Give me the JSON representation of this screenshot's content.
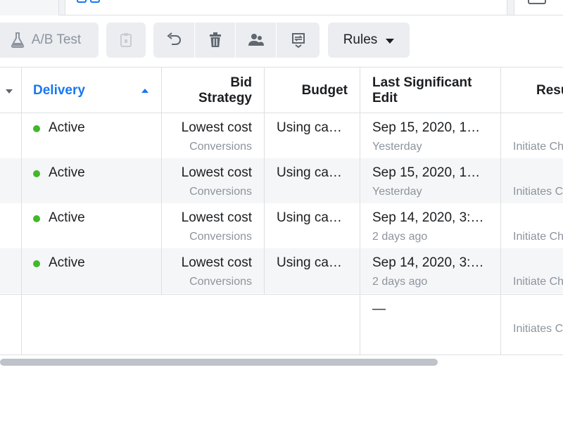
{
  "toolbar": {
    "ab_test_label": "A/B Test",
    "rules_label": "Rules"
  },
  "table": {
    "headers": {
      "delivery": "Delivery",
      "bid_strategy_line1": "Bid",
      "bid_strategy_line2": "Strategy",
      "budget": "Budget",
      "last_edit_line1": "Last Significant",
      "last_edit_line2": "Edit",
      "results": "Resu"
    },
    "rows": [
      {
        "delivery": "Active",
        "bid": "Lowest cost",
        "bid_sub": "Conversions",
        "budget": "Using ca…",
        "edit": "Sep 15, 2020, 1…",
        "edit_sub": "Yesterday",
        "results_sub": "Initiate Ch"
      },
      {
        "delivery": "Active",
        "bid": "Lowest cost",
        "bid_sub": "Conversions",
        "budget": "Using ca…",
        "edit": "Sep 15, 2020, 1…",
        "edit_sub": "Yesterday",
        "results_sub": "Initiates C"
      },
      {
        "delivery": "Active",
        "bid": "Lowest cost",
        "bid_sub": "Conversions",
        "budget": "Using ca…",
        "edit": "Sep 14, 2020, 3:…",
        "edit_sub": "2 days ago",
        "results_sub": "Initiate Ch"
      },
      {
        "delivery": "Active",
        "bid": "Lowest cost",
        "bid_sub": "Conversions",
        "budget": "Using ca…",
        "edit": "Sep 14, 2020, 3:…",
        "edit_sub": "2 days ago",
        "results_sub": "Initiate Ch"
      }
    ],
    "totals": {
      "edit": "—",
      "results_sub": "Initiates C"
    }
  },
  "colors": {
    "accent": "#1877f2",
    "active_dot": "#42b72a",
    "muted_text": "#8d949e"
  }
}
